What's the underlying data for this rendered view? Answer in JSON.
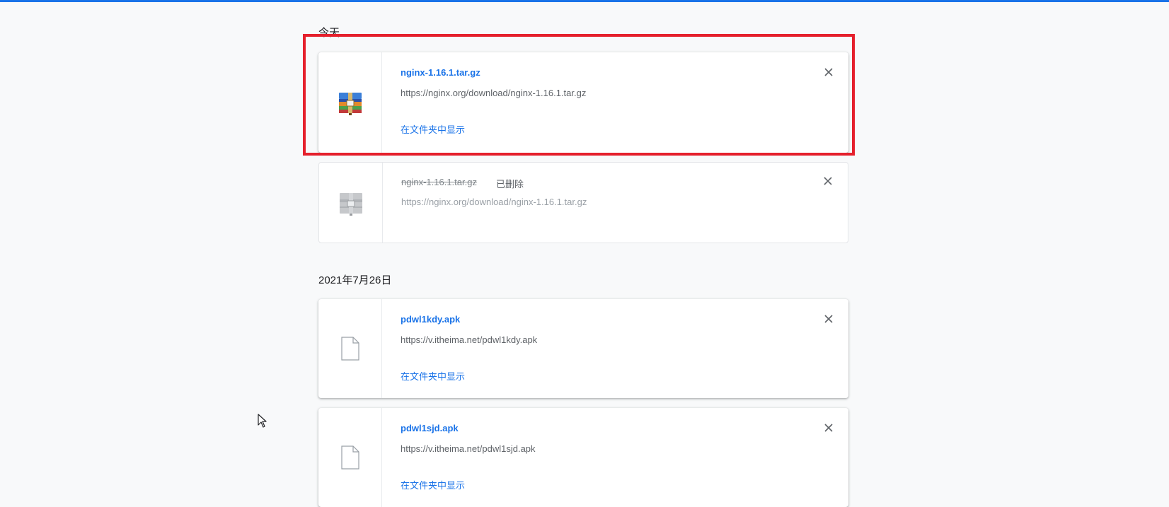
{
  "sections": [
    {
      "title": "今天",
      "downloads": [
        {
          "filename": "nginx-1.16.1.tar.gz",
          "url": "https://nginx.org/download/nginx-1.16.1.tar.gz",
          "action": "在文件夹中显示",
          "icon": "archive-icon"
        },
        {
          "filename": "nginx-1.16.1.tar.gz",
          "status": "已删除",
          "url": "https://nginx.org/download/nginx-1.16.1.tar.gz",
          "icon": "archive-icon-gray"
        }
      ]
    },
    {
      "title": "2021年7月26日",
      "downloads": [
        {
          "filename": "pdwl1kdy.apk",
          "url": "https://v.itheima.net/pdwl1kdy.apk",
          "action": "在文件夹中显示",
          "icon": "file-icon"
        },
        {
          "filename": "pdwl1sjd.apk",
          "url": "https://v.itheima.net/pdwl1sjd.apk",
          "action": "在文件夹中显示",
          "icon": "file-icon"
        }
      ]
    }
  ],
  "colors": {
    "accent": "#1a73e8",
    "highlight": "#e5202c",
    "background": "#f8f9fa"
  }
}
